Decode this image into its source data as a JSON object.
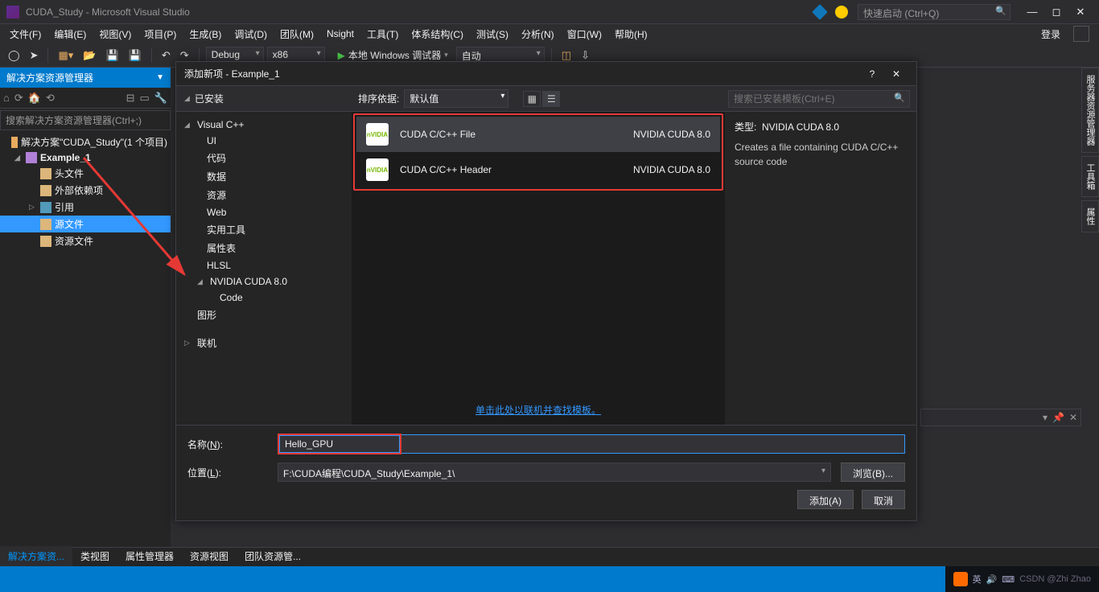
{
  "title_bar": {
    "title": "CUDA_Study - Microsoft Visual Studio",
    "quick_launch_placeholder": "快速启动 (Ctrl+Q)"
  },
  "menu": {
    "items": [
      "文件(F)",
      "编辑(E)",
      "视图(V)",
      "项目(P)",
      "生成(B)",
      "调试(D)",
      "团队(M)",
      "Nsight",
      "工具(T)",
      "体系结构(C)",
      "测试(S)",
      "分析(N)",
      "窗口(W)",
      "帮助(H)"
    ],
    "login": "登录"
  },
  "toolbar": {
    "config": "Debug",
    "platform": "x86",
    "debugger": "本地 Windows 调试器",
    "auto": "自动"
  },
  "solution_panel": {
    "title": "解决方案资源管理器",
    "search_placeholder": "搜索解决方案资源管理器(Ctrl+;)",
    "solution": "解决方案\"CUDA_Study\"(1 个项目)",
    "project": "Example_1",
    "nodes": [
      "头文件",
      "外部依赖项",
      "引用",
      "源文件",
      "资源文件"
    ]
  },
  "right_tabs": [
    "服务器资源管理器",
    "工具箱",
    "属性"
  ],
  "bottom_tabs": [
    "解决方案资...",
    "类视图",
    "属性管理器",
    "资源视图",
    "团队资源管..."
  ],
  "dialog": {
    "title": "添加新项 - Example_1",
    "installed": "已安装",
    "sort_label": "排序依据:",
    "sort_value": "默认值",
    "search_placeholder": "搜索已安装模板(Ctrl+E)",
    "left_tree": {
      "visual_cpp": "Visual C++",
      "children": [
        "UI",
        "代码",
        "数据",
        "资源",
        "Web",
        "实用工具",
        "属性表",
        "HLSL"
      ],
      "nvidia": "NVIDIA CUDA 8.0",
      "nvidia_child": "Code",
      "graphics": "图形",
      "online": "联机"
    },
    "templates": [
      {
        "name": "CUDA C/C++ File",
        "type": "NVIDIA CUDA 8.0"
      },
      {
        "name": "CUDA C/C++ Header",
        "type": "NVIDIA CUDA 8.0"
      }
    ],
    "online_link": "单击此处以联机并查找模板。",
    "detail": {
      "type_label": "类型:",
      "type_value": "NVIDIA CUDA 8.0",
      "desc": "Creates a file containing CUDA C/C++ source code"
    },
    "name_label": "名称(N):",
    "name_value": "Hello_GPU",
    "location_label": "位置(L):",
    "location_value": "F:\\CUDA编程\\CUDA_Study\\Example_1\\",
    "browse": "浏览(B)...",
    "add": "添加(A)",
    "cancel": "取消"
  },
  "watermark": "CSDN @Zhi Zhao"
}
